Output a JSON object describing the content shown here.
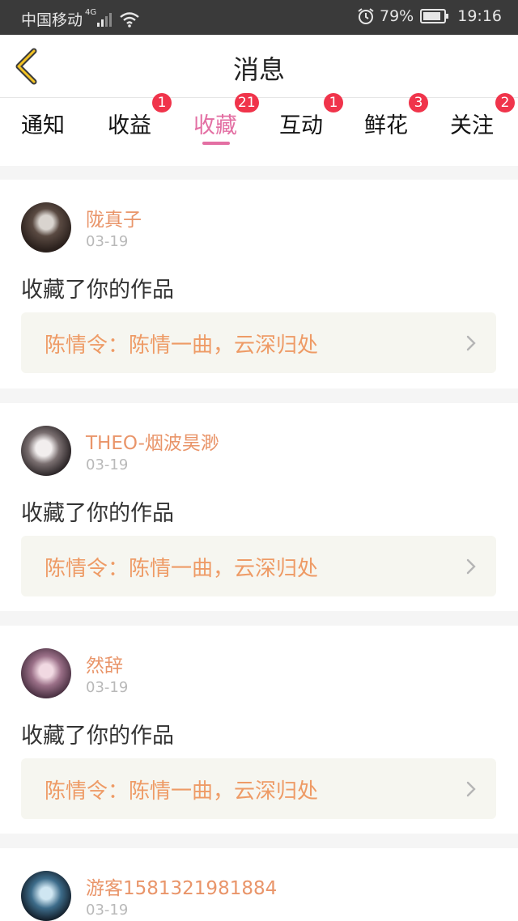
{
  "status_bar": {
    "carrier": "中国移动",
    "network": "4G",
    "battery": "79%",
    "time": "19:16"
  },
  "header": {
    "title": "消息"
  },
  "tabs": [
    {
      "label": "通知",
      "badge": ""
    },
    {
      "label": "收益",
      "badge": "1"
    },
    {
      "label": "收藏",
      "badge": "21",
      "active": true
    },
    {
      "label": "互动",
      "badge": "1"
    },
    {
      "label": "鲜花",
      "badge": "3"
    },
    {
      "label": "关注",
      "badge": "2"
    }
  ],
  "items": [
    {
      "user": "陇真子",
      "date": "03-19",
      "action": "收藏了你的作品",
      "work": "陈情令：陈情一曲，云深归处"
    },
    {
      "user": "THEO-烟波昊渺",
      "date": "03-19",
      "action": "收藏了你的作品",
      "work": "陈情令：陈情一曲，云深归处"
    },
    {
      "user": "然辞",
      "date": "03-19",
      "action": "收藏了你的作品",
      "work": "陈情令：陈情一曲，云深归处"
    },
    {
      "user": "游客1581321981884",
      "date": "03-19"
    }
  ],
  "colors": {
    "accent": "#e36fa3",
    "badge": "#f0344b",
    "username": "#e9956a",
    "work_title": "#ee9b66",
    "status_bar": "#3a3a3a"
  },
  "icons": [
    "signal-icon",
    "wifi-icon",
    "alarm-icon",
    "battery-icon",
    "back-arrow-icon",
    "chevron-right-icon",
    "avatar"
  ]
}
